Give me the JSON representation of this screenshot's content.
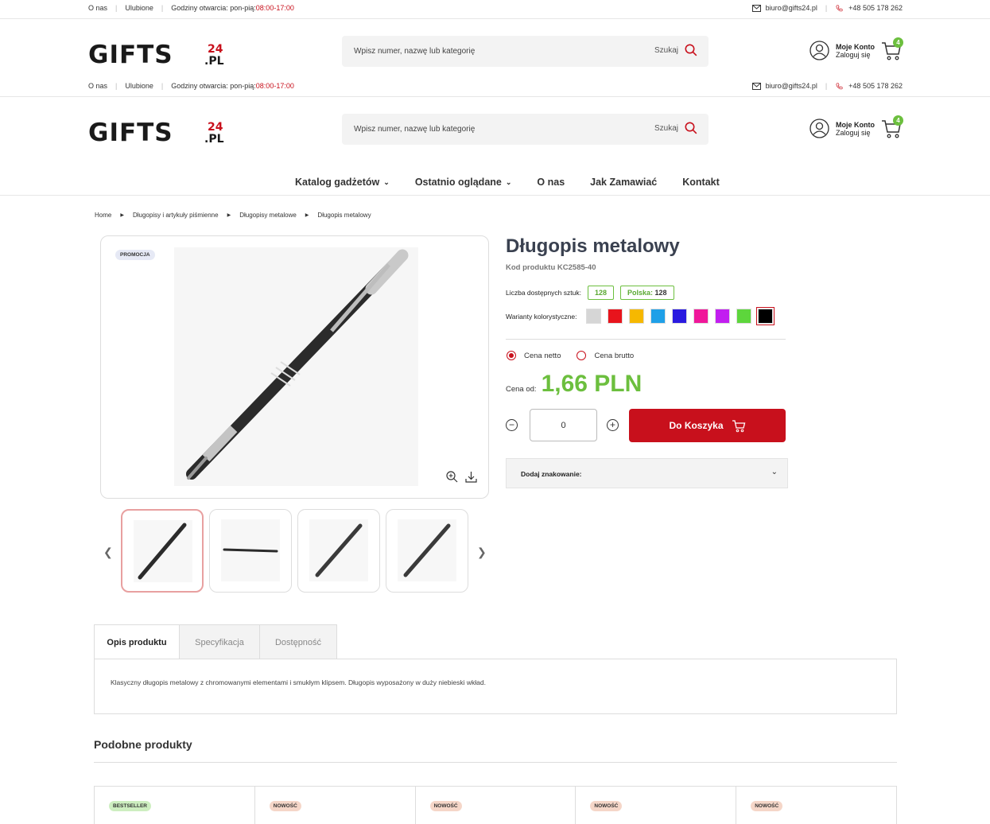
{
  "topbar": {
    "about": "O nas",
    "favorites": "Ulubione",
    "hours_label": "Godziny otwarcia: pon-pią: ",
    "hours_time": "08:00-17:00",
    "email": "biuro@gifts24.pl",
    "phone": "+48 505 178 262"
  },
  "header": {
    "logo_text": "GIFTS",
    "logo_suffix_top": "24",
    "logo_suffix_bottom": ".PL",
    "search_placeholder": "Wpisz numer, nazwę lub kategorię",
    "search_button": "Szukaj",
    "account_title": "Moje Konto",
    "account_sub": "Zaloguj się",
    "cart_count": "4"
  },
  "nav": {
    "items": [
      {
        "label": "Katalog gadżetów",
        "chevron": true
      },
      {
        "label": "Ostatnio oglądane",
        "chevron": true
      },
      {
        "label": "O nas",
        "chevron": false
      },
      {
        "label": "Jak Zamawiać",
        "chevron": false
      },
      {
        "label": "Kontakt",
        "chevron": false
      }
    ]
  },
  "breadcrumb": [
    "Home",
    "Długopisy i artykuły piśmienne",
    "Długopisy metalowe",
    "Długopis metalowy"
  ],
  "product": {
    "promo_badge": "PROMOCJA",
    "title": "Długopis metalowy",
    "code": "Kod produktu KC2585-40",
    "stock_label": "Liczba dostępnych sztuk:",
    "stock_total": "128",
    "stock_pl_label": "Polska:",
    "stock_pl_value": "128",
    "variants_label": "Warianty kolorystyczne:",
    "variants": [
      "#d6d6d6",
      "#e8141c",
      "#f6b800",
      "#1fa0e8",
      "#2a1ae0",
      "#f0179a",
      "#c21ef0",
      "#5dd63c",
      "#000000"
    ],
    "active_variant": 8,
    "price_net_label": "Cena netto",
    "price_gross_label": "Cena brutto",
    "price_from_label": "Cena od:",
    "price_value": "1,66 PLN",
    "quantity": "0",
    "add_to_cart": "Do Koszyka",
    "marking_label": "Dodaj znakowanie:"
  },
  "tabs": {
    "items": [
      "Opis produktu",
      "Specyfikacja",
      "Dostępność"
    ],
    "active": 0,
    "description": "Klasyczny długopis metalowy z chromowanymi elementami i smukłym klipsem. Długopis wyposażony w duży niebieski wkład."
  },
  "similar": {
    "title": "Podobne produkty",
    "badges": [
      "BESTSELLER",
      "NOWOŚĆ",
      "NOWOŚĆ",
      "NOWOŚĆ",
      "NOWOŚĆ"
    ]
  },
  "colors": {
    "brand_red": "#c8101c",
    "accent_green": "#6cbf3e"
  }
}
